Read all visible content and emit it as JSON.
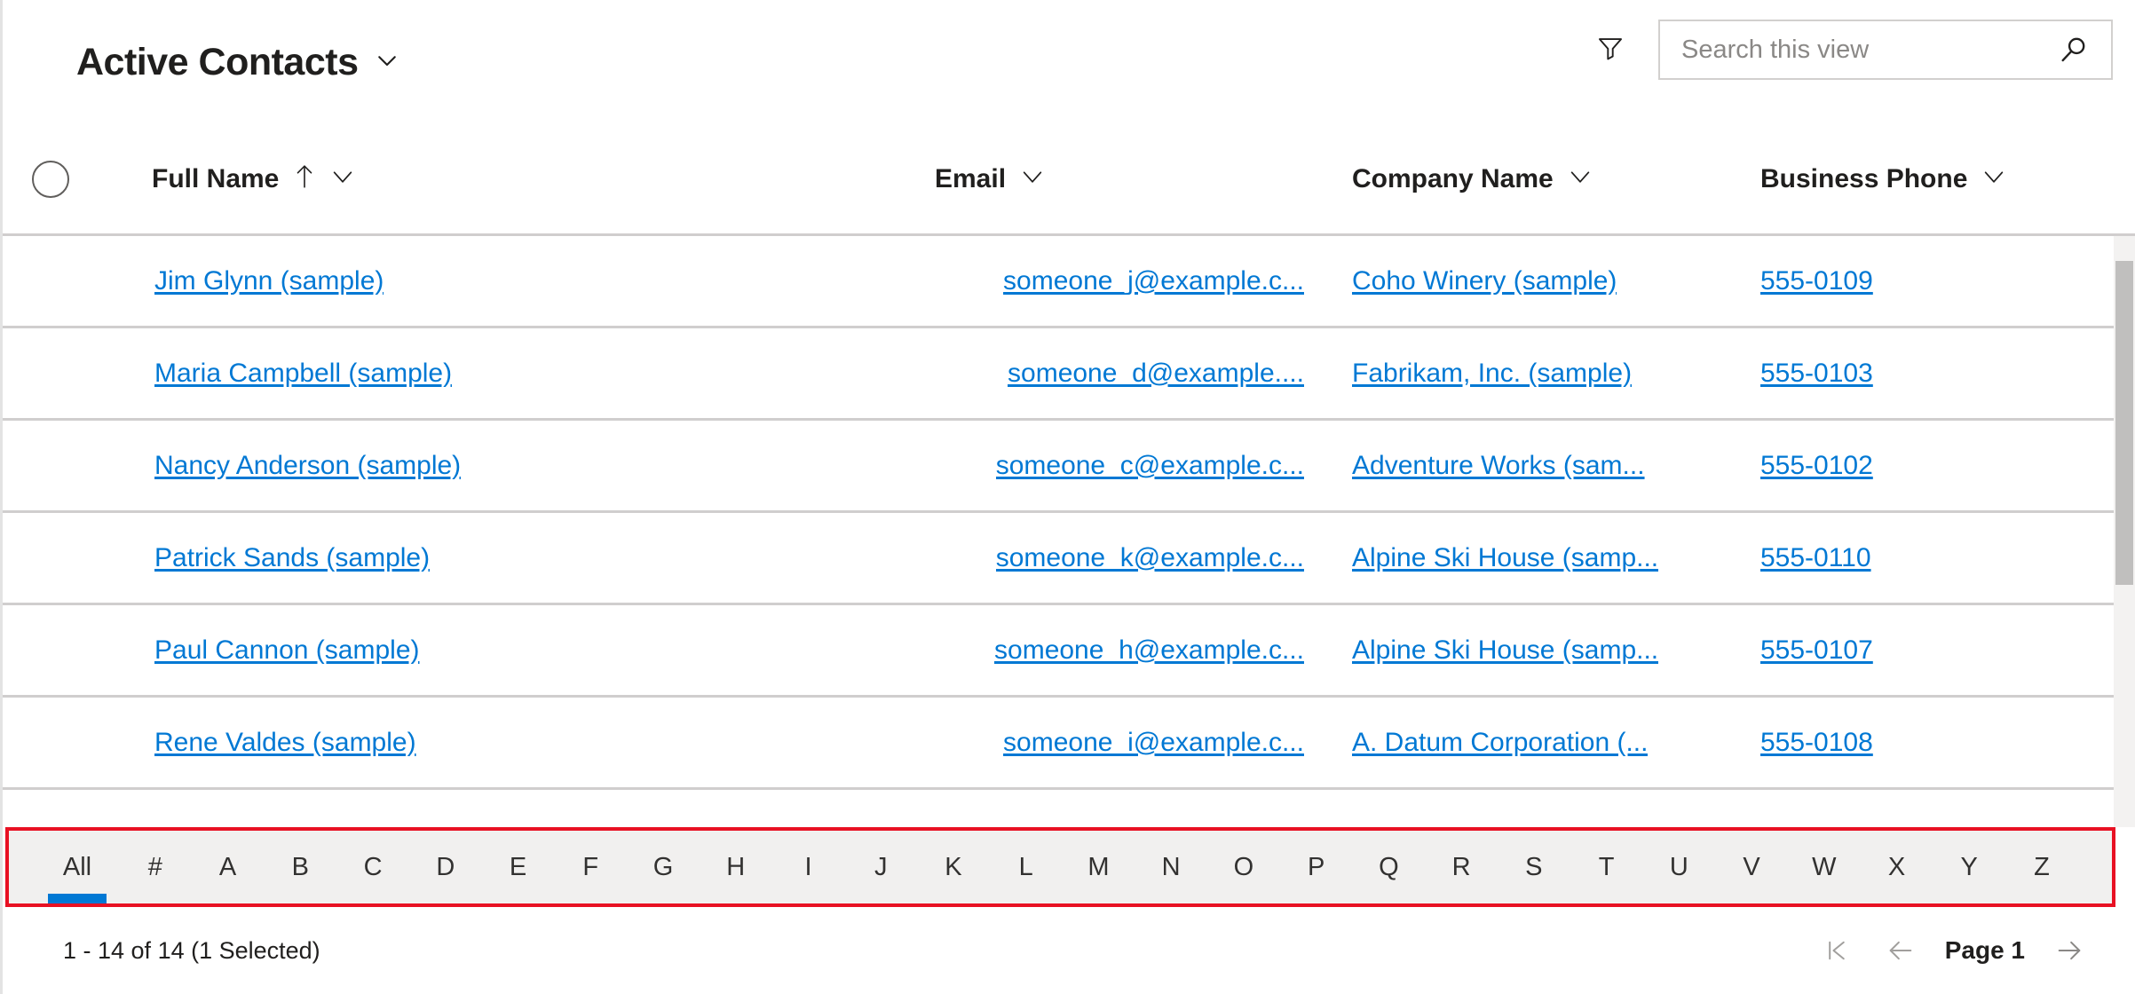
{
  "header": {
    "view_title": "Active Contacts",
    "view_chevron_icon": "chevron-down-icon",
    "filter_icon": "filter-icon",
    "search": {
      "placeholder": "Search this view",
      "value": "",
      "icon": "search-icon"
    }
  },
  "grid": {
    "select_all_icon": "selection-circle-icon",
    "columns": [
      {
        "label": "Full Name",
        "sort_icon": "arrow-up-icon",
        "menu_icon": "chevron-down-icon",
        "sorted": true
      },
      {
        "label": "Email",
        "menu_icon": "chevron-down-icon",
        "sorted": false
      },
      {
        "label": "Company Name",
        "menu_icon": "chevron-down-icon",
        "sorted": false
      },
      {
        "label": "Business Phone",
        "menu_icon": "chevron-down-icon",
        "sorted": false
      }
    ],
    "rows": [
      {
        "full_name": "Jim Glynn (sample)",
        "email": "someone_j@example.c...",
        "company": "Coho Winery (sample)",
        "phone": "555-0109"
      },
      {
        "full_name": "Maria Campbell (sample)",
        "email": "someone_d@example....",
        "company": "Fabrikam, Inc. (sample)",
        "phone": "555-0103"
      },
      {
        "full_name": "Nancy Anderson (sample)",
        "email": "someone_c@example.c...",
        "company": "Adventure Works (sam...",
        "phone": "555-0102"
      },
      {
        "full_name": "Patrick Sands (sample)",
        "email": "someone_k@example.c...",
        "company": "Alpine Ski House (samp...",
        "phone": "555-0110"
      },
      {
        "full_name": "Paul Cannon (sample)",
        "email": "someone_h@example.c...",
        "company": "Alpine Ski House (samp...",
        "phone": "555-0107"
      },
      {
        "full_name": "Rene Valdes (sample)",
        "email": "someone_i@example.c...",
        "company": "A. Datum Corporation (...",
        "phone": "555-0108"
      }
    ],
    "scrollbar": {
      "name": "vertical-scrollbar"
    }
  },
  "alpha_filter": {
    "highlight_color": "#e81123",
    "active_color": "#0078d4",
    "selected": "All",
    "items": [
      "All",
      "#",
      "A",
      "B",
      "C",
      "D",
      "E",
      "F",
      "G",
      "H",
      "I",
      "J",
      "K",
      "L",
      "M",
      "N",
      "O",
      "P",
      "Q",
      "R",
      "S",
      "T",
      "U",
      "V",
      "W",
      "X",
      "Y",
      "Z"
    ]
  },
  "footer": {
    "status": "1 - 14 of 14 (1 Selected)",
    "page_label": "Page 1",
    "first_page_icon": "first-page-icon",
    "prev_page_icon": "arrow-left-icon",
    "next_page_icon": "arrow-right-icon"
  }
}
